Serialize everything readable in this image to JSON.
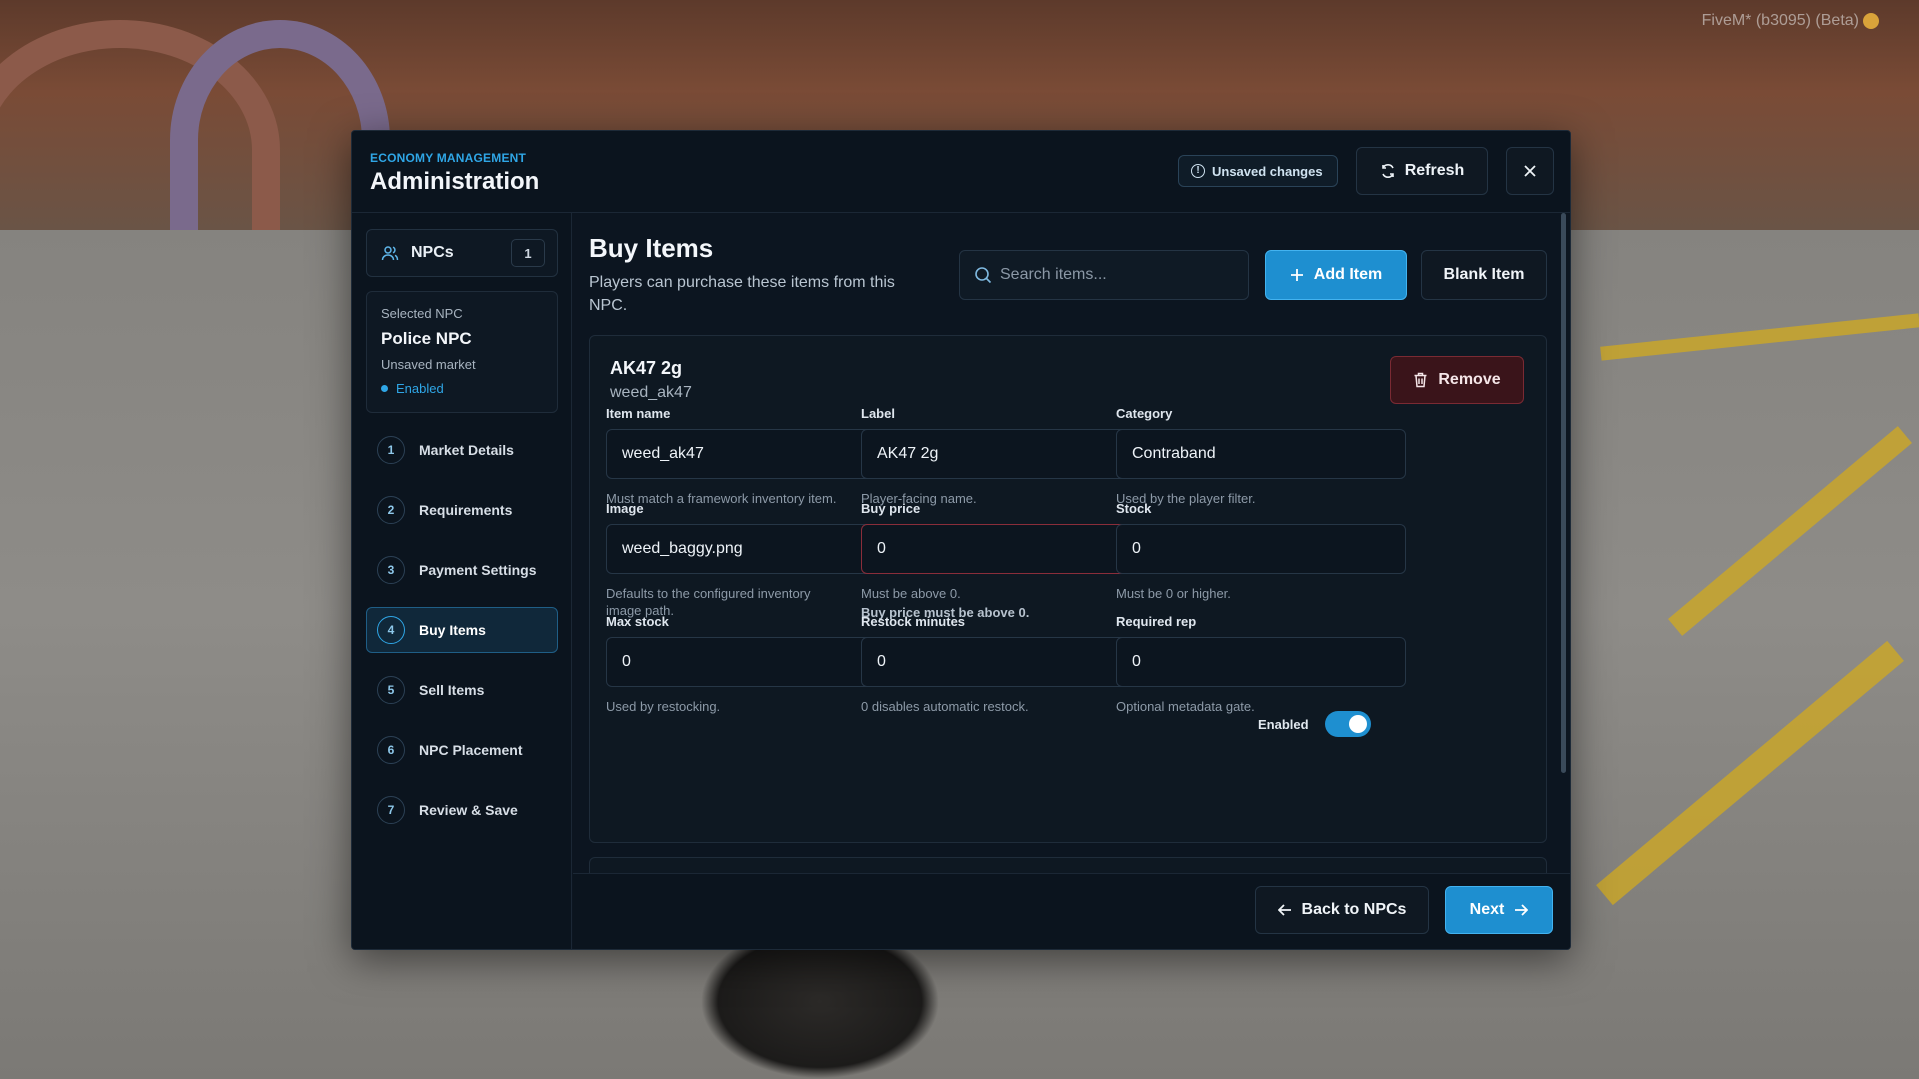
{
  "window": {
    "watermark": "FiveM* (b3095) (Beta)"
  },
  "header": {
    "subtitle": "ECONOMY MANAGEMENT",
    "title": "Administration",
    "unsaved_label": "Unsaved changes",
    "refresh_label": "Refresh"
  },
  "sidebar": {
    "npcs_label": "NPCs",
    "npcs_count": "1",
    "selected_caption": "Selected NPC",
    "selected_name": "Police NPC",
    "selected_sub": "Unsaved market",
    "selected_status": "Enabled",
    "steps": [
      {
        "num": "1",
        "label": "Market Details"
      },
      {
        "num": "2",
        "label": "Requirements"
      },
      {
        "num": "3",
        "label": "Payment Settings"
      },
      {
        "num": "4",
        "label": "Buy Items"
      },
      {
        "num": "5",
        "label": "Sell Items"
      },
      {
        "num": "6",
        "label": "NPC Placement"
      },
      {
        "num": "7",
        "label": "Review & Save"
      }
    ]
  },
  "main": {
    "title": "Buy Items",
    "description": "Players can purchase these items from this NPC.",
    "search_placeholder": "Search items...",
    "add_label": "Add Item",
    "blank_label": "Blank Item",
    "item": {
      "title": "AK47 2g",
      "subtitle": "weed_ak47",
      "remove_label": "Remove",
      "fields": {
        "item_name": {
          "label": "Item name",
          "value": "weed_ak47",
          "help": "Must match a framework inventory item."
        },
        "label": {
          "label": "Label",
          "value": "AK47 2g",
          "help": "Player-facing name."
        },
        "category": {
          "label": "Category",
          "value": "Contraband",
          "help": "Used by the player filter."
        },
        "image": {
          "label": "Image",
          "value": "weed_baggy.png",
          "help": "Defaults to the configured inventory image path."
        },
        "buy_price": {
          "label": "Buy price",
          "value": "0",
          "help": "Must be above 0.",
          "error": "Buy price must be above 0."
        },
        "stock": {
          "label": "Stock",
          "value": "0",
          "help": "Must be 0 or higher."
        },
        "max_stock": {
          "label": "Max stock",
          "value": "0",
          "help": "Used by restocking."
        },
        "restock_minutes": {
          "label": "Restock minutes",
          "value": "0",
          "help": "0 disables automatic restock."
        },
        "required_rep": {
          "label": "Required rep",
          "value": "0",
          "help": "Optional metadata gate."
        }
      },
      "enabled_label": "Enabled",
      "enabled": true
    }
  },
  "footer": {
    "back_label": "Back to NPCs",
    "next_label": "Next"
  },
  "colors": {
    "accent": "#1e8fd0",
    "accent_text": "#2fa6e6",
    "danger_bg": "#3a141a",
    "panel_bg": "#0c1520"
  }
}
